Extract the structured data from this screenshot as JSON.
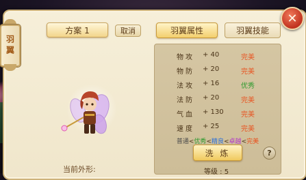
{
  "side_tab": {
    "label": "羽翼"
  },
  "left": {
    "scheme_button": "方案 1",
    "cancel_button": "取消",
    "current_look_label": "当前外形:"
  },
  "tabs": [
    {
      "label": "羽翼属性",
      "active": true
    },
    {
      "label": "羽翼技能",
      "active": false
    }
  ],
  "stats": [
    {
      "name": "物攻",
      "value": "+ 40",
      "grade": "完美",
      "grade_color": "#e8521f"
    },
    {
      "name": "物防",
      "value": "+ 20",
      "grade": "完美",
      "grade_color": "#e8521f"
    },
    {
      "name": "法攻",
      "value": "+ 16",
      "grade": "优秀",
      "grade_color": "#2e9a2e"
    },
    {
      "name": "法防",
      "value": "+ 20",
      "grade": "完美",
      "grade_color": "#e8521f"
    },
    {
      "name": "气血",
      "value": "+ 130",
      "grade": "完美",
      "grade_color": "#e8521f"
    },
    {
      "name": "速度",
      "value": "+ 25",
      "grade": "完美",
      "grade_color": "#e8521f"
    }
  ],
  "grade_legend": [
    {
      "text": "普通",
      "color": "#4a4a4a"
    },
    {
      "text": "<",
      "color": "#4a3418"
    },
    {
      "text": "优秀",
      "color": "#2e9a2e"
    },
    {
      "text": "<",
      "color": "#4a3418"
    },
    {
      "text": "精良",
      "color": "#2a6fd8"
    },
    {
      "text": "<",
      "color": "#4a3418"
    },
    {
      "text": "卓越",
      "color": "#b237c9"
    },
    {
      "text": "<",
      "color": "#4a3418"
    },
    {
      "text": "完美",
      "color": "#e8521f"
    }
  ],
  "refine_button": "洗 炼",
  "help_icon": "?",
  "level_text": "等级 : 5",
  "close_icon": "✕"
}
